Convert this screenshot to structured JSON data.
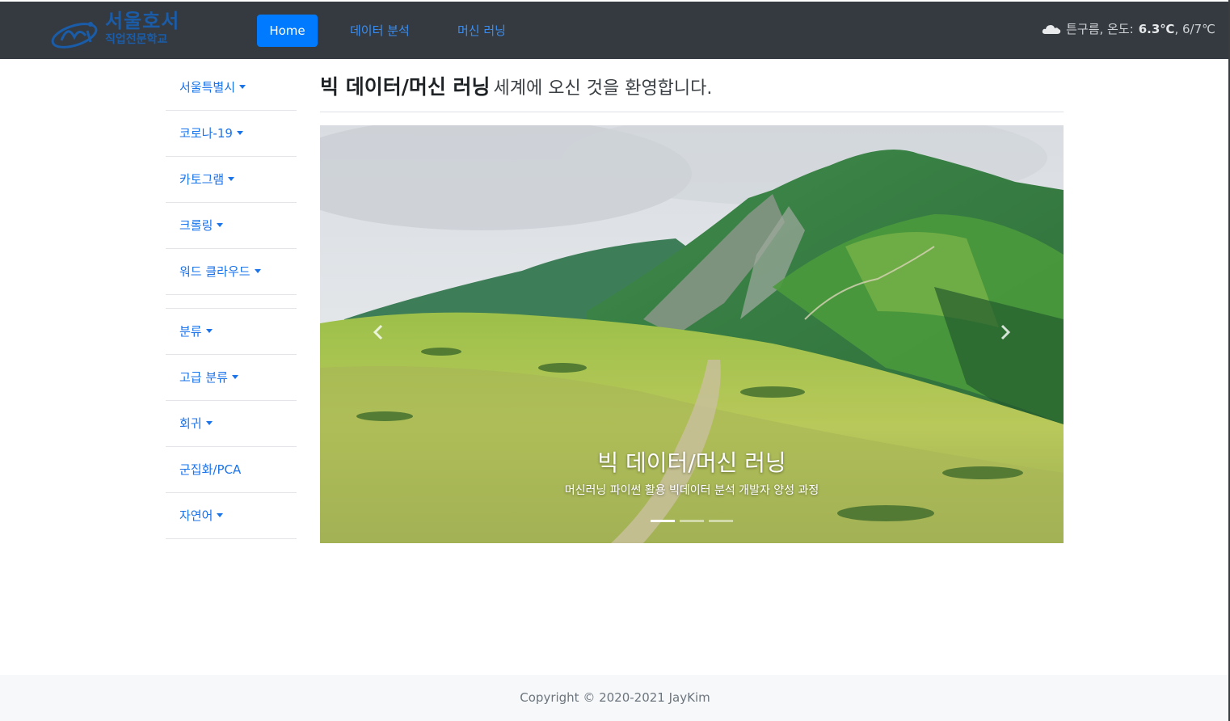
{
  "brand": {
    "line1": "서울호서",
    "line2": "직업전문학교"
  },
  "nav": {
    "home": "Home",
    "links": [
      "데이터 분석",
      "머신 러닝"
    ]
  },
  "weather": {
    "icon": "cloud-icon",
    "condition_label": "튼구름, 온도:",
    "temp": "6.3℃",
    "range": ", 6/7℃"
  },
  "sidebar": {
    "group1": [
      {
        "label": "서울특별시",
        "dropdown": true
      },
      {
        "label": "코로나-19",
        "dropdown": true
      },
      {
        "label": "카토그램",
        "dropdown": true
      },
      {
        "label": "크롤링",
        "dropdown": true
      },
      {
        "label": "워드 클라우드",
        "dropdown": true
      }
    ],
    "group2": [
      {
        "label": "분류",
        "dropdown": true
      },
      {
        "label": "고급 분류",
        "dropdown": true
      },
      {
        "label": "회귀",
        "dropdown": true
      },
      {
        "label": "군집화/PCA",
        "dropdown": false
      },
      {
        "label": "자연어",
        "dropdown": true
      }
    ]
  },
  "main": {
    "title_strong": "빅 데이터/머신 러닝",
    "title_rest": "세계에 오신 것을 환영합니다."
  },
  "carousel": {
    "caption_title": "빅 데이터/머신 러닝",
    "caption_sub": "머신러닝 파이썬 활용 빅데이터 분석 개발자 양성 과정",
    "slides": 3,
    "active_slide": 1
  },
  "footer": {
    "copyright": "Copyright © 2020-2021 JayKim"
  }
}
